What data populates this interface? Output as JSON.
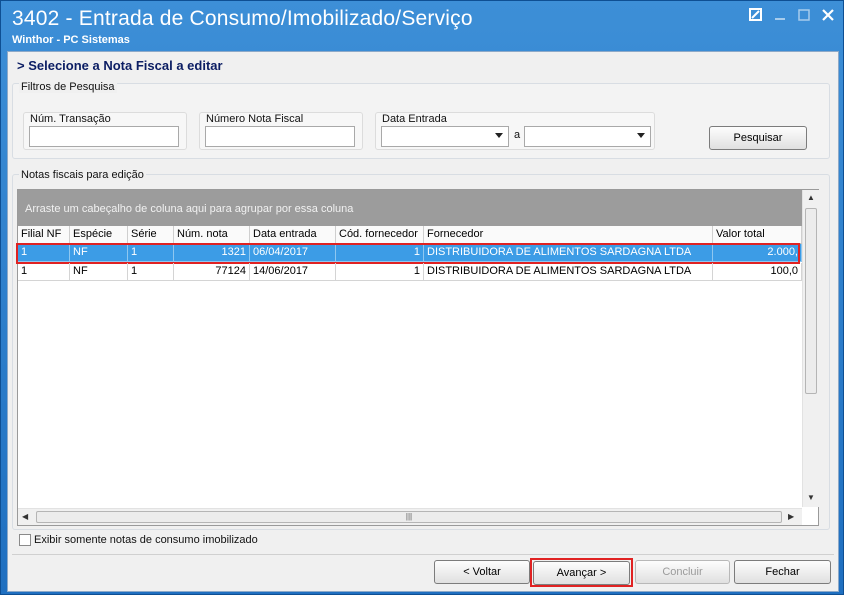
{
  "window": {
    "title": "3402 - Entrada de Consumo/Imobilizado/Serviço",
    "subtitle": "Winthor - PC Sistemas",
    "controls": [
      "restore-icon",
      "minimize-icon",
      "maximize-icon",
      "close-icon"
    ]
  },
  "header": {
    "text": "> Selecione a Nota Fiscal a editar"
  },
  "filters": {
    "group_label": "Filtros de Pesquisa",
    "transacao": {
      "label": "Núm. Transação",
      "value": ""
    },
    "nota_fiscal": {
      "label": "Número Nota Fiscal",
      "value": ""
    },
    "data_entrada": {
      "label": "Data Entrada",
      "from": "",
      "separator": "a",
      "to": ""
    },
    "search_button": "Pesquisar"
  },
  "grid": {
    "group_label": "Notas fiscais para edição",
    "groupby_hint": "Arraste um cabeçalho de coluna aqui para agrupar por essa coluna",
    "columns": [
      "Filial NF",
      "Espécie",
      "Série",
      "Núm. nota",
      "Data entrada",
      "Cód. fornecedor",
      "Fornecedor",
      "Valor total"
    ],
    "rows": [
      {
        "filial": "1",
        "especie": "NF",
        "serie": "1",
        "num_nota": "1321",
        "data": "06/04/2017",
        "cod_forn": "1",
        "fornecedor": "DISTRIBUIDORA DE ALIMENTOS SARDAGNA LTDA",
        "valor": "2.000,",
        "selected": true
      },
      {
        "filial": "1",
        "especie": "NF",
        "serie": "1",
        "num_nota": "77124",
        "data": "14/06/2017",
        "cod_forn": "1",
        "fornecedor": "DISTRIBUIDORA DE ALIMENTOS SARDAGNA LTDA",
        "valor": "100,0",
        "selected": false
      }
    ]
  },
  "options": {
    "only_consumo": {
      "label": "Exibir somente notas de consumo imobilizado",
      "checked": false
    }
  },
  "footer": {
    "voltar": "< Voltar",
    "avancar": "Avançar >",
    "concluir": "Concluir",
    "fechar": "Fechar"
  },
  "colors": {
    "title_bar": "#2a7acb",
    "selection": "#3c9ce6",
    "highlight": "#e02222"
  }
}
